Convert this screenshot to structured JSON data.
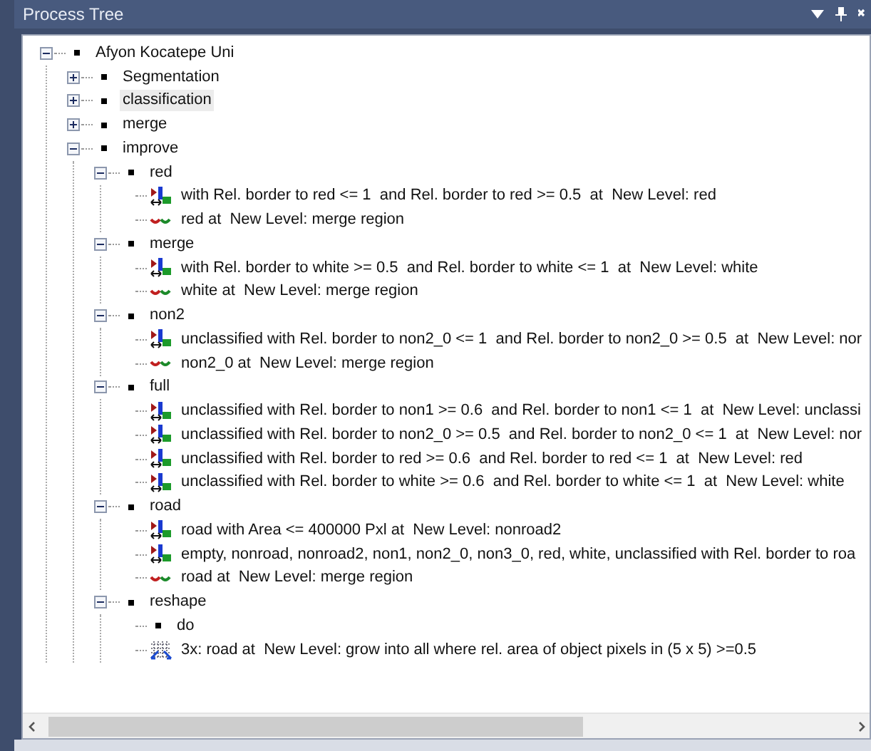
{
  "panel": {
    "title": "Process Tree"
  },
  "tree": [
    {
      "label": "Afyon Kocatepe Uni",
      "kind": "folder",
      "expanded": true,
      "selected": false,
      "children": [
        {
          "label": "Segmentation",
          "kind": "folder",
          "expanded": false,
          "selected": false
        },
        {
          "label": "classification",
          "kind": "folder",
          "expanded": false,
          "selected": true
        },
        {
          "label": "merge",
          "kind": "folder",
          "expanded": false,
          "selected": false
        },
        {
          "label": "improve",
          "kind": "folder",
          "expanded": true,
          "selected": false,
          "children": [
            {
              "label": "red",
              "kind": "folder",
              "expanded": true,
              "selected": false,
              "children": [
                {
                  "label": "with Rel. border to red <= 1  and Rel. border to red >= 0.5  at  New Level: red",
                  "kind": "classify",
                  "selected": false
                },
                {
                  "label": "red at  New Level: merge region",
                  "kind": "merge",
                  "selected": false
                }
              ]
            },
            {
              "label": "merge",
              "kind": "folder",
              "expanded": true,
              "selected": false,
              "children": [
                {
                  "label": "with Rel. border to white >= 0.5  and Rel. border to white <= 1  at  New Level: white",
                  "kind": "classify",
                  "selected": false
                },
                {
                  "label": "white at  New Level: merge region",
                  "kind": "merge",
                  "selected": false
                }
              ]
            },
            {
              "label": "non2",
              "kind": "folder",
              "expanded": true,
              "selected": false,
              "children": [
                {
                  "label": "unclassified with Rel. border to non2_0 <= 1  and Rel. border to non2_0 >= 0.5  at  New Level: nor",
                  "kind": "classify",
                  "selected": false
                },
                {
                  "label": "non2_0 at  New Level: merge region",
                  "kind": "merge",
                  "selected": false
                }
              ]
            },
            {
              "label": "full",
              "kind": "folder",
              "expanded": true,
              "selected": false,
              "children": [
                {
                  "label": "unclassified with Rel. border to non1 >= 0.6  and Rel. border to non1 <= 1  at  New Level: unclassi",
                  "kind": "classify",
                  "selected": false
                },
                {
                  "label": "unclassified with Rel. border to non2_0 >= 0.5  and Rel. border to non2_0 <= 1  at  New Level: nor",
                  "kind": "classify",
                  "selected": false
                },
                {
                  "label": "unclassified with Rel. border to red >= 0.6  and Rel. border to red <= 1  at  New Level: red",
                  "kind": "classify",
                  "selected": false
                },
                {
                  "label": "unclassified with Rel. border to white >= 0.6  and Rel. border to white <= 1  at  New Level: white",
                  "kind": "classify",
                  "selected": false
                }
              ]
            },
            {
              "label": "road",
              "kind": "folder",
              "expanded": true,
              "selected": false,
              "children": [
                {
                  "label": "road with Area <= 400000 Pxl at  New Level: nonroad2",
                  "kind": "classify",
                  "selected": false
                },
                {
                  "label": "empty, nonroad, nonroad2, non1, non2_0, non3_0, red, white, unclassified with Rel. border to roa",
                  "kind": "classify",
                  "selected": false
                },
                {
                  "label": "road at  New Level: merge region",
                  "kind": "merge",
                  "selected": false
                }
              ]
            },
            {
              "label": "reshape",
              "kind": "folder",
              "expanded": true,
              "selected": false,
              "children": [
                {
                  "label": "do",
                  "kind": "folder",
                  "selected": false
                },
                {
                  "label": "3x: road at  New Level: grow into all where rel. area of object pixels in (5 x 5) >=0.5",
                  "kind": "grow",
                  "selected": false
                }
              ]
            }
          ]
        }
      ]
    }
  ]
}
